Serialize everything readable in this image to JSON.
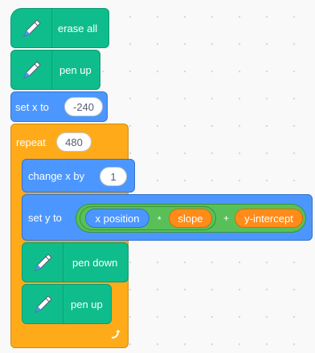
{
  "blocks": {
    "erase_all": {
      "label": "erase all",
      "icon": "pen-icon"
    },
    "pen_up_1": {
      "label": "pen up",
      "icon": "pen-icon"
    },
    "set_x": {
      "label": "set x to",
      "value": "-240"
    },
    "repeat": {
      "label": "repeat",
      "value": "480",
      "loop_icon": "loop-arrow-icon"
    },
    "change_x": {
      "label": "change x by",
      "value": "1"
    },
    "set_y": {
      "label": "set y to",
      "expression": {
        "x_position": "x position",
        "times": "*",
        "slope": "slope",
        "plus": "+",
        "y_intercept": "y-intercept"
      }
    },
    "pen_down": {
      "label": "pen down",
      "icon": "pen-icon"
    },
    "pen_up_2": {
      "label": "pen up",
      "icon": "pen-icon"
    }
  },
  "colors": {
    "pen": "#0fbd8c",
    "motion": "#4c97ff",
    "control": "#ffab19",
    "operators": "#59c059",
    "variables": "#ff8c1a",
    "canvas": "#f9f9f9"
  }
}
